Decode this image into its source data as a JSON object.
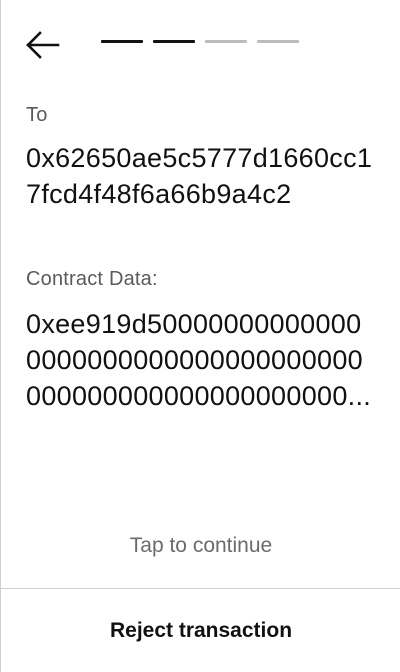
{
  "header": {
    "back_icon": "arrow-left-icon",
    "progress": {
      "total_steps": 4,
      "current_step": 2,
      "active_color": "#111111",
      "inactive_color": "#bdbdbd"
    }
  },
  "fields": {
    "to_label": "To",
    "to_value": "0x62650ae5c5777d1660cc17fcd4f48f6a66b9a4c2",
    "data_label": "Contract Data:",
    "data_value": "0xee919d500000000000000000000000000000000000000000000000000000000..."
  },
  "actions": {
    "tap_to_continue": "Tap to continue",
    "reject_label": "Reject transaction"
  }
}
